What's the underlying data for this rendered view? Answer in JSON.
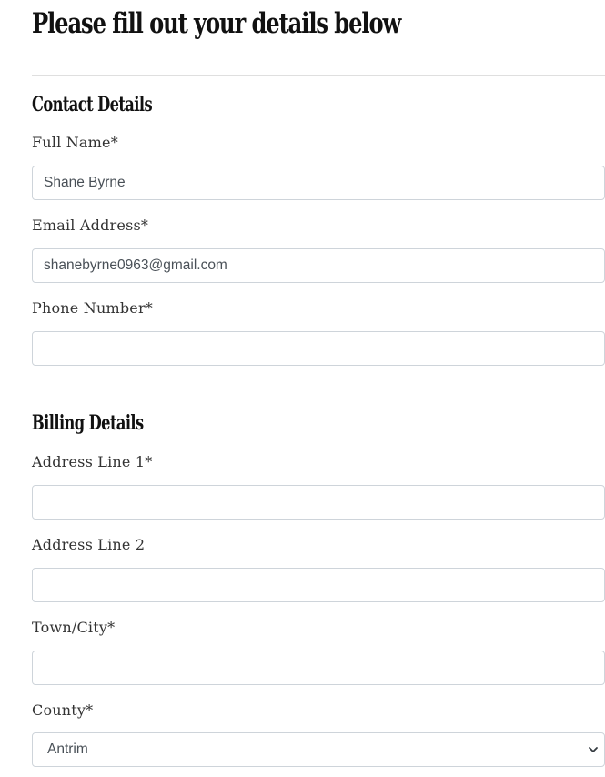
{
  "page": {
    "title": "Please fill out your details below"
  },
  "contact": {
    "heading": "Contact Details",
    "full_name": {
      "label": "Full Name*",
      "value": "Shane Byrne"
    },
    "email": {
      "label": "Email Address*",
      "value": "shanebyrne0963@gmail.com"
    },
    "phone": {
      "label": "Phone Number*",
      "value": ""
    }
  },
  "billing": {
    "heading": "Billing Details",
    "address_line_1": {
      "label": "Address Line 1*",
      "value": ""
    },
    "address_line_2": {
      "label": "Address Line 2",
      "value": ""
    },
    "town_city": {
      "label": "Town/City*",
      "value": ""
    },
    "county": {
      "label": "County*",
      "selected": "Antrim"
    }
  },
  "icons": {
    "select_arrow": "chevron-down-icon"
  }
}
